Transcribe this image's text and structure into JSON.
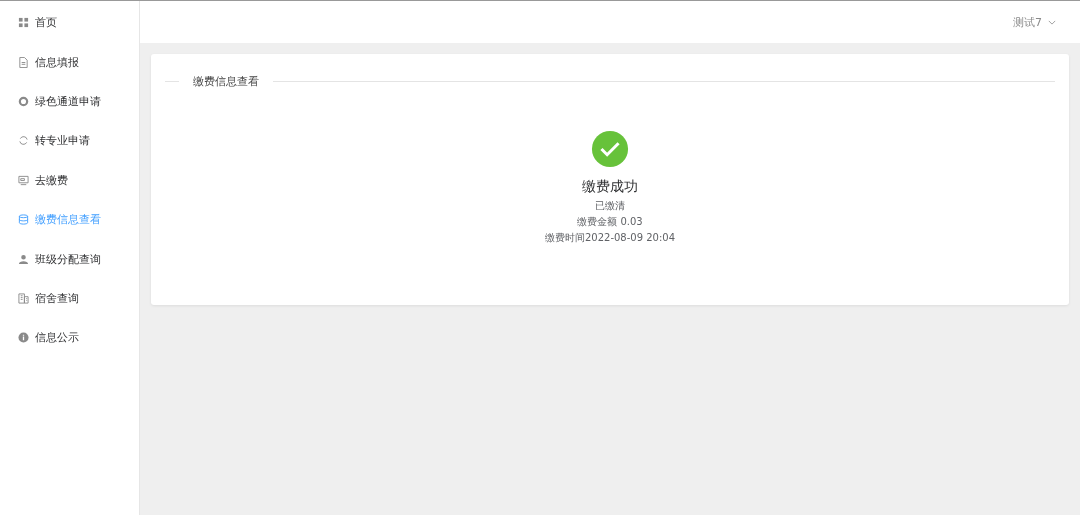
{
  "sidebar": {
    "items": [
      {
        "label": "首页",
        "selected": false
      },
      {
        "label": "信息填报",
        "selected": false
      },
      {
        "label": "绿色通道申请",
        "selected": false
      },
      {
        "label": "转专业申请",
        "selected": false
      },
      {
        "label": "去缴费",
        "selected": false
      },
      {
        "label": "缴费信息查看",
        "selected": true
      },
      {
        "label": "班级分配查询",
        "selected": false
      },
      {
        "label": "宿舍查询",
        "selected": false
      },
      {
        "label": "信息公示",
        "selected": false
      }
    ]
  },
  "header": {
    "user": "测试7"
  },
  "card": {
    "title": "缴费信息查看",
    "result": {
      "kind": "success",
      "title": "缴费成功",
      "status": "已缴清",
      "amount": "缴费金额 0.03",
      "time": "缴费时间2022-08-09 20:04"
    }
  }
}
